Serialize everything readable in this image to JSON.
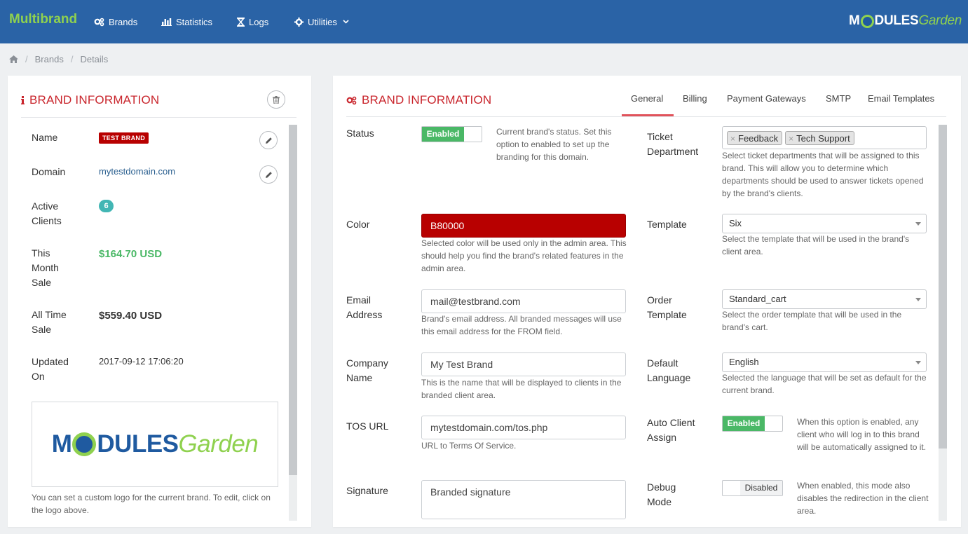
{
  "nav": {
    "app_title": "Multibrand",
    "items": [
      {
        "label": "Brands",
        "icon": "gears-icon"
      },
      {
        "label": "Statistics",
        "icon": "bar-chart-icon"
      },
      {
        "label": "Logs",
        "icon": "hourglass-icon"
      },
      {
        "label": "Utilities",
        "icon": "gear-icon"
      }
    ],
    "logo": {
      "part1": "M",
      "part2": "DULES",
      "part3": "Garden"
    }
  },
  "breadcrumb": {
    "home_icon": "home-icon",
    "brands": "Brands",
    "details": "Details"
  },
  "left": {
    "title": "BRAND INFORMATION",
    "name_label": "Name",
    "name_badge": "TEST BRAND",
    "domain_label": "Domain",
    "domain_value": "mytestdomain.com",
    "active_clients_label_1": "Active",
    "active_clients_label_2": "Clients",
    "active_clients_value": "6",
    "month_label_1": "This",
    "month_label_2": "Month",
    "month_label_3": "Sale",
    "month_value": "$164.70 USD",
    "alltime_label_1": "All Time",
    "alltime_label_2": "Sale",
    "alltime_value": "$559.40 USD",
    "updated_label_1": "Updated",
    "updated_label_2": "On",
    "updated_value": "2017-09-12 17:06:20",
    "logo": {
      "part1": "M",
      "part2": "DULES",
      "part3": "Garden"
    },
    "logo_help": "You can set a custom logo for the current brand. To edit, click on the logo above."
  },
  "right": {
    "title": "BRAND INFORMATION",
    "tabs": [
      "General",
      "Billing",
      "Payment Gateways",
      "SMTP",
      "Email Templates"
    ],
    "status": {
      "label": "Status",
      "toggle": "Enabled",
      "help": "Current brand's status. Set this option to enabled to set up the branding for this domain."
    },
    "color": {
      "label": "Color",
      "value": "B80000",
      "help": "Selected color will be used only in the admin area. This should help you find the brand's related features in the admin area.",
      "swatch": "#b80000"
    },
    "email": {
      "label_1": "Email",
      "label_2": "Address",
      "value": "mail@testbrand.com",
      "help": "Brand's email address. All branded messages will use this email address for the FROM field."
    },
    "company": {
      "label_1": "Company",
      "label_2": "Name",
      "value": "My Test Brand",
      "help": "This is the name that will be displayed to clients in the branded client area."
    },
    "tos": {
      "label": "TOS URL",
      "value": "mytestdomain.com/tos.php",
      "help": "URL to Terms Of Service."
    },
    "signature": {
      "label": "Signature",
      "value": "Branded signature"
    },
    "ticket": {
      "label_1": "Ticket",
      "label_2": "Department",
      "tags": [
        "Feedback",
        "Tech Support"
      ],
      "help": "Select ticket departments that will be assigned to this brand. This will allow you to determine which departments should be used to answer tickets opened by the brand's clients."
    },
    "template": {
      "label": "Template",
      "value": "Six",
      "help": "Select the template that will be used in the brand's client area."
    },
    "order_template": {
      "label_1": "Order",
      "label_2": "Template",
      "value": "Standard_cart",
      "help": "Select the order template that will be used in the brand's cart."
    },
    "language": {
      "label_1": "Default",
      "label_2": "Language",
      "value": "English",
      "help": "Selected the language that will be set as default for the current brand."
    },
    "auto_assign": {
      "label_1": "Auto Client",
      "label_2": "Assign",
      "toggle": "Enabled",
      "help": "When this option is enabled, any client who will log in to this brand will be automatically assigned to it."
    },
    "debug": {
      "label_1": "Debug",
      "label_2": "Mode",
      "toggle": "Disabled",
      "help": "When enabled, this mode also disables the redirection in the client area."
    }
  }
}
